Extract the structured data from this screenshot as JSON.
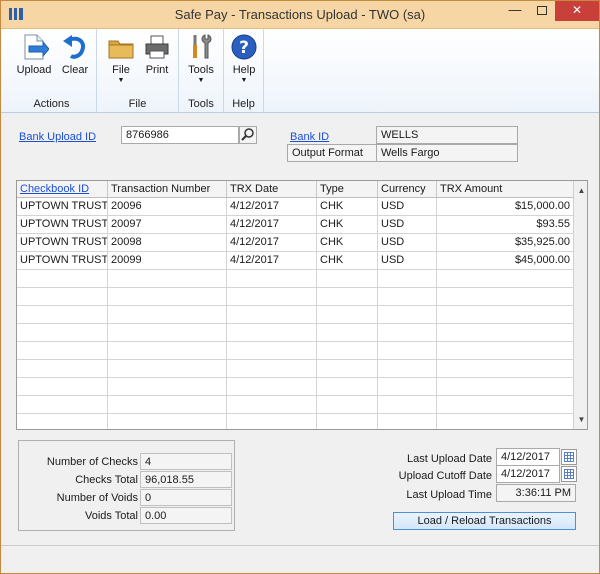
{
  "window": {
    "title": "Safe Pay - Transactions Upload  -  TWO (sa)",
    "minimize_glyph": "—",
    "close_glyph": "✕"
  },
  "ribbon": {
    "groups": [
      {
        "label": "Actions",
        "buttons": [
          {
            "label": "Upload",
            "icon": "upload-icon"
          },
          {
            "label": "Clear",
            "icon": "undo-arrow-icon"
          }
        ]
      },
      {
        "label": "File",
        "buttons": [
          {
            "label": "File",
            "icon": "folder-icon"
          },
          {
            "label": "Print",
            "icon": "printer-icon"
          }
        ]
      },
      {
        "label": "Tools",
        "buttons": [
          {
            "label": "Tools",
            "icon": "tools-icon"
          }
        ]
      },
      {
        "label": "Help",
        "buttons": [
          {
            "label": "Help",
            "icon": "help-icon"
          }
        ]
      }
    ],
    "dropdown_glyph": "▼"
  },
  "form": {
    "bank_upload_id_label": "Bank Upload ID",
    "bank_upload_id_value": "8766986",
    "bank_id_label": "Bank ID",
    "bank_id_value": "WELLS",
    "output_format_label": "Output Format",
    "output_format_value": "Wells Fargo"
  },
  "grid": {
    "columns": [
      "Checkbook ID",
      "Transaction Number",
      "TRX Date",
      "Type",
      "Currency",
      "TRX Amount"
    ],
    "rows": [
      [
        "UPTOWN TRUST",
        "20096",
        "4/12/2017",
        "CHK",
        "USD",
        "$15,000.00"
      ],
      [
        "UPTOWN TRUST",
        "20097",
        "4/12/2017",
        "CHK",
        "USD",
        "$93.55"
      ],
      [
        "UPTOWN TRUST",
        "20098",
        "4/12/2017",
        "CHK",
        "USD",
        "$35,925.00"
      ],
      [
        "UPTOWN TRUST",
        "20099",
        "4/12/2017",
        "CHK",
        "USD",
        "$45,000.00"
      ]
    ],
    "scroll_up_glyph": "▲",
    "scroll_down_glyph": "▼"
  },
  "summary": {
    "number_of_checks_label": "Number of Checks",
    "number_of_checks_value": "4",
    "checks_total_label": "Checks Total",
    "checks_total_value": "96,018.55",
    "number_of_voids_label": "Number of Voids",
    "number_of_voids_value": "0",
    "voids_total_label": "Voids Total",
    "voids_total_value": "0.00"
  },
  "upload_info": {
    "last_upload_date_label": "Last Upload Date",
    "last_upload_date_value": "4/12/2017",
    "upload_cutoff_date_label": "Upload Cutoff Date",
    "upload_cutoff_date_value": "4/12/2017",
    "last_upload_time_label": "Last Upload Time",
    "last_upload_time_value": "3:36:11 PM"
  },
  "load_button_label": "Load / Reload Transactions"
}
